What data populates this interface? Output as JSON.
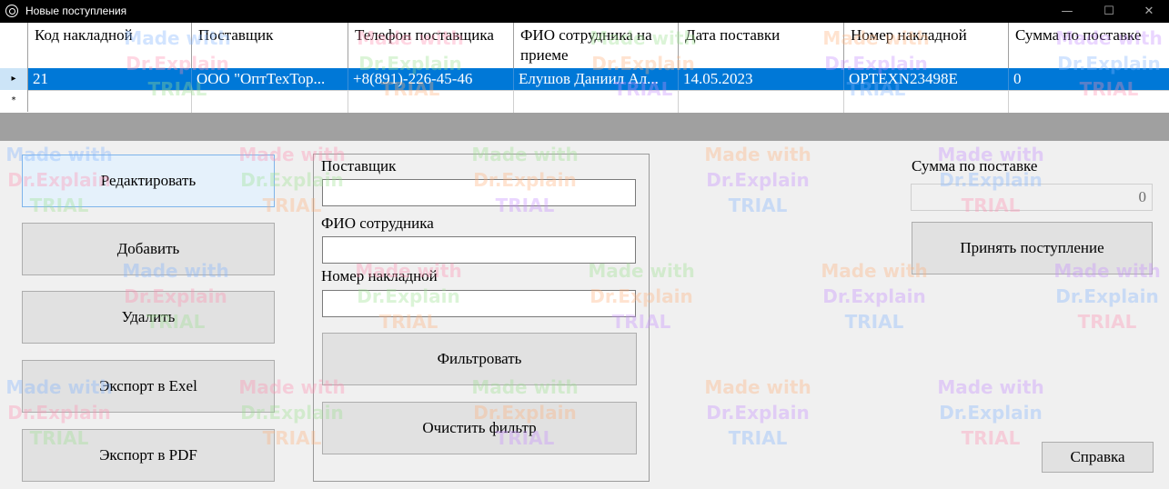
{
  "window": {
    "title": "Новые поступления",
    "minimize_glyph": "—",
    "maximize_glyph": "☐",
    "close_glyph": "✕",
    "icon": "app-icon"
  },
  "grid": {
    "columns": [
      "Код накладной",
      "Поставщик",
      "Телефон поставщика",
      "ФИО сотрудника на приеме",
      "Дата поставки",
      "Номер накладной",
      "Сумма по поставке"
    ],
    "selected_row_marker": "▸",
    "new_row_marker": "*",
    "rows": [
      [
        "21",
        "ООО \"ОптТехТор...",
        "+8(891)-226-45-46",
        "Елушов Даниил Ал...",
        "14.05.2023",
        "OPTEXN23498E",
        "0"
      ]
    ]
  },
  "buttons": {
    "edit": "Редактировать",
    "add": "Добавить",
    "delete": "Удалить",
    "export_excel": "Экспорт в Exel",
    "export_pdf": "Экспорт в PDF",
    "filter": "Фильтровать",
    "clear_filter": "Очистить фильтр",
    "accept": "Принять поступление",
    "help": "Справка"
  },
  "filter": {
    "supplier_label": "Поставщик",
    "supplier_value": "",
    "employee_label": "ФИО сотрудника",
    "employee_value": "",
    "invoice_label": "Номер накладной",
    "invoice_value": ""
  },
  "summary": {
    "sum_label": "Сумма по поставке",
    "sum_value": "0"
  },
  "watermark": {
    "line1": "Made with",
    "line2": "Dr.Explain",
    "line3": "TRIAL",
    "colors": [
      "#7fb3ff",
      "#ff8fb0",
      "#9be08f",
      "#ffb07a",
      "#c58cff"
    ]
  }
}
